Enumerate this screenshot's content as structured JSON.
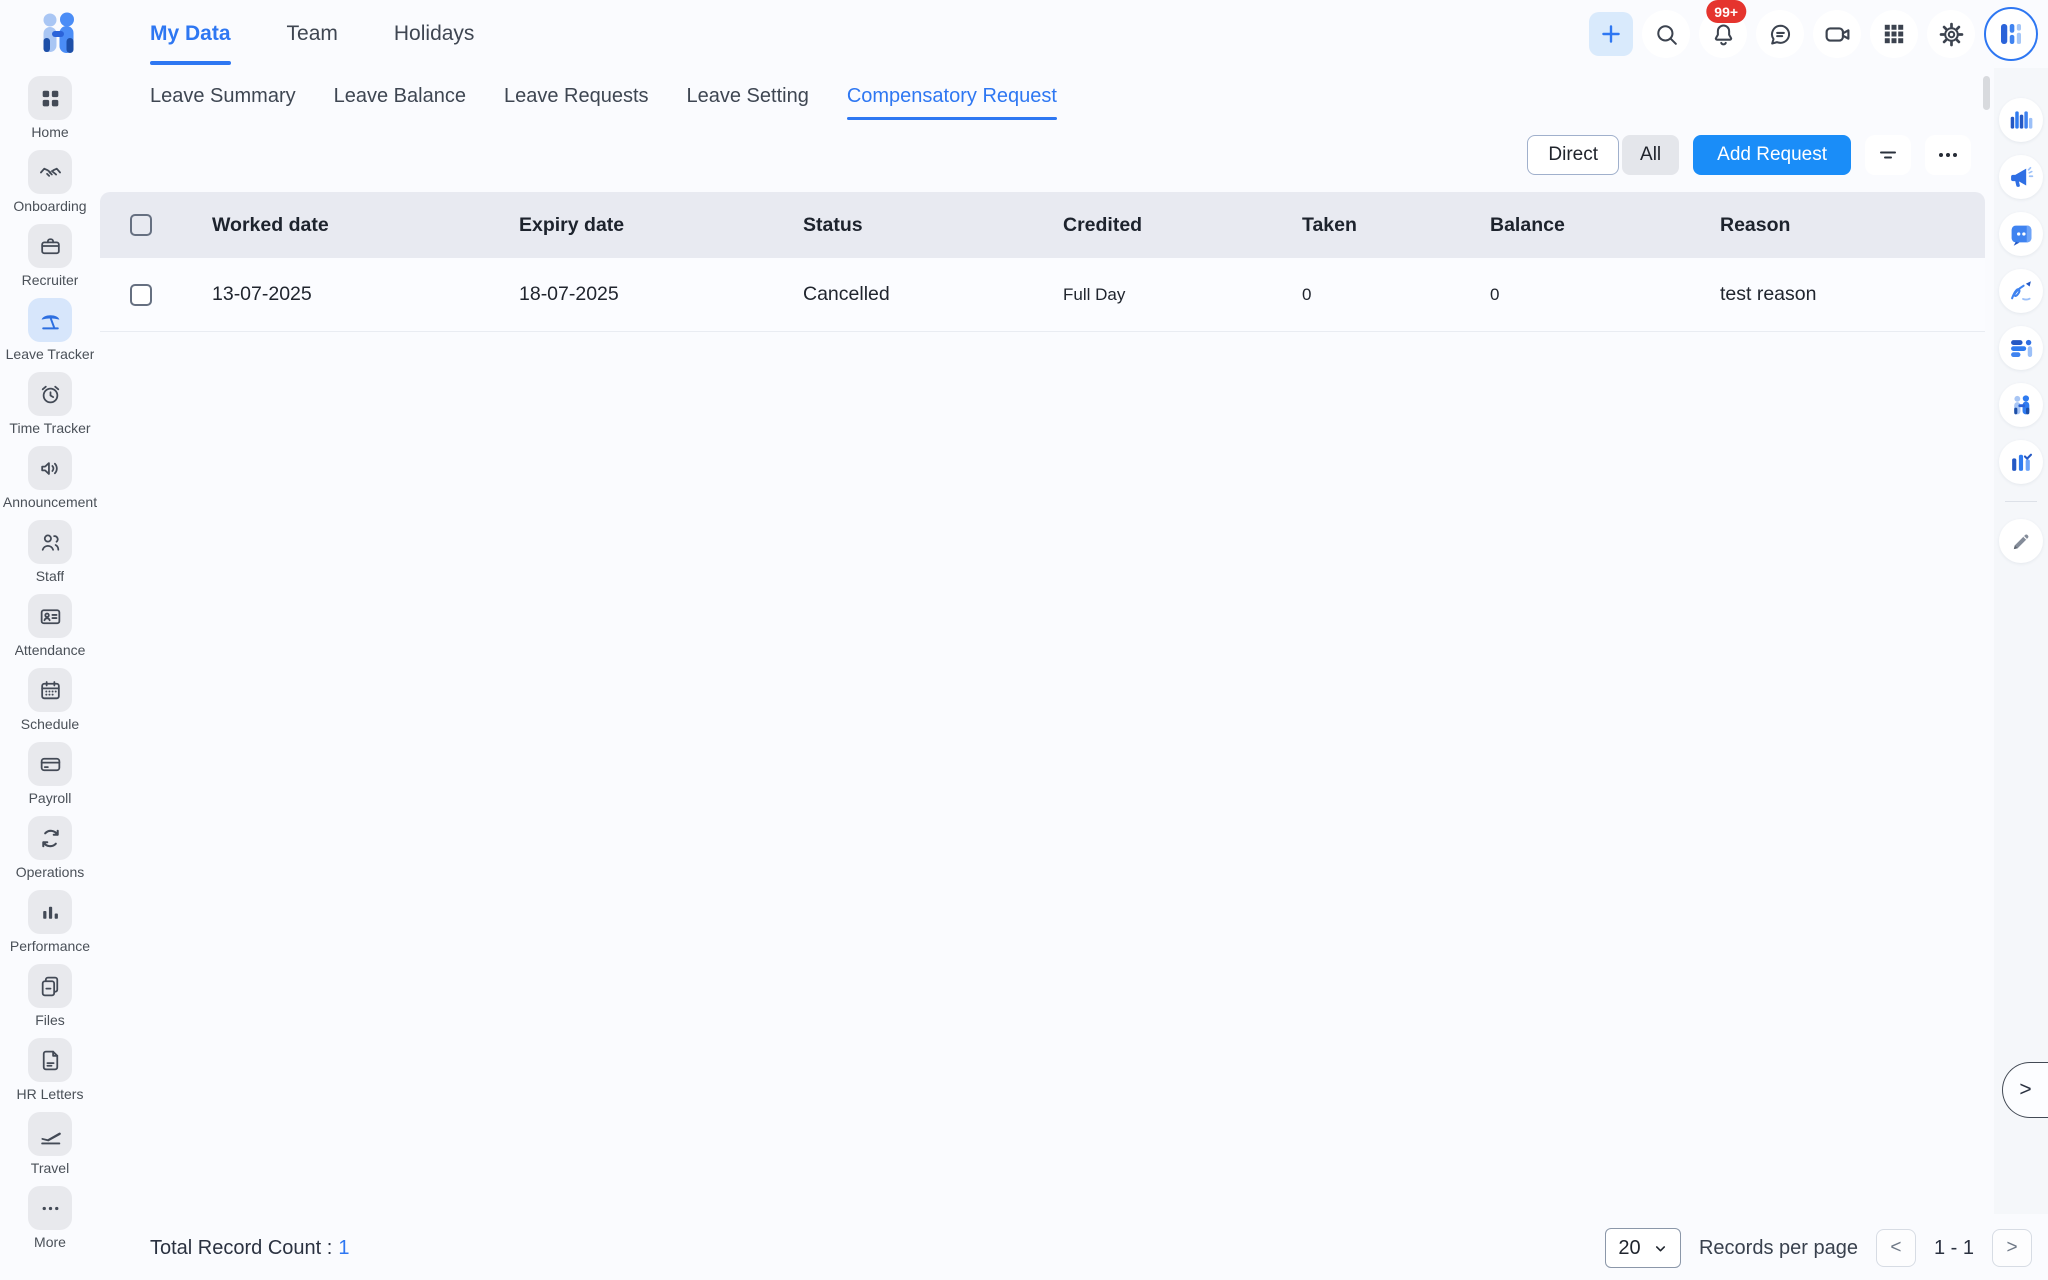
{
  "topbar": {
    "tabs": [
      "My Data",
      "Team",
      "Holidays"
    ],
    "active_tab": "My Data",
    "notification_badge": "99+",
    "icons": [
      "plus-icon",
      "search-icon",
      "bell-icon",
      "chat-icon",
      "video-icon",
      "apps-grid-icon",
      "gear-icon",
      "avatar"
    ]
  },
  "sidebar": {
    "active_item": "Leave Tracker",
    "items": [
      {
        "label": "Home",
        "icon": "home-icon"
      },
      {
        "label": "Onboarding",
        "icon": "handshake-icon"
      },
      {
        "label": "Recruiter",
        "icon": "briefcase-icon"
      },
      {
        "label": "Leave Tracker",
        "icon": "beach-umbrella-icon"
      },
      {
        "label": "Time Tracker",
        "icon": "alarm-clock-icon"
      },
      {
        "label": "Announcement",
        "icon": "speaker-icon"
      },
      {
        "label": "Staff",
        "icon": "people-icon"
      },
      {
        "label": "Attendance",
        "icon": "id-card-icon"
      },
      {
        "label": "Schedule",
        "icon": "calendar-icon"
      },
      {
        "label": "Payroll",
        "icon": "credit-card-icon"
      },
      {
        "label": "Operations",
        "icon": "sync-icon"
      },
      {
        "label": "Performance",
        "icon": "bar-chart-icon"
      },
      {
        "label": "Files",
        "icon": "documents-icon"
      },
      {
        "label": "HR Letters",
        "icon": "document-icon"
      },
      {
        "label": "Travel",
        "icon": "plane-icon"
      },
      {
        "label": "More",
        "icon": "ellipsis-icon"
      }
    ]
  },
  "subtabs": {
    "items": [
      "Leave Summary",
      "Leave Balance",
      "Leave Requests",
      "Leave Setting",
      "Compensatory Request"
    ],
    "active": "Compensatory Request"
  },
  "toolbar": {
    "direct_label": "Direct",
    "all_label": "All",
    "add_request_label": "Add Request",
    "icons": [
      "filter-icon",
      "ellipsis-icon"
    ]
  },
  "table": {
    "columns": [
      "Worked date",
      "Expiry date",
      "Status",
      "Credited",
      "Taken",
      "Balance",
      "Reason"
    ],
    "rows": [
      {
        "worked_date": "13-07-2025",
        "expiry_date": "18-07-2025",
        "status": "Cancelled",
        "credited": "Full Day",
        "taken": "0",
        "balance": "0",
        "reason": "test reason"
      }
    ]
  },
  "footer": {
    "total_label": "Total Record Count :",
    "total_value": "1",
    "page_size": "20",
    "records_per_page_label": "Records per page",
    "prev_label": "<",
    "range_label": "1 - 1",
    "next_label": ">"
  },
  "right_rail": {
    "icons": [
      "analytics-icon",
      "megaphone-icon",
      "chat-app-icon",
      "signature-icon",
      "tasks-icon",
      "people-app-icon",
      "projects-icon",
      "pencil-icon"
    ],
    "expand_label": ">"
  },
  "colors": {
    "accent_blue": "#2e77f2",
    "add_button_blue": "#1a8df8",
    "badge_red": "#e5342e",
    "table_header_bg": "#e8eaf1",
    "active_item_bg": "#d7e6fb",
    "rail_bg": "#f5f7fa"
  }
}
